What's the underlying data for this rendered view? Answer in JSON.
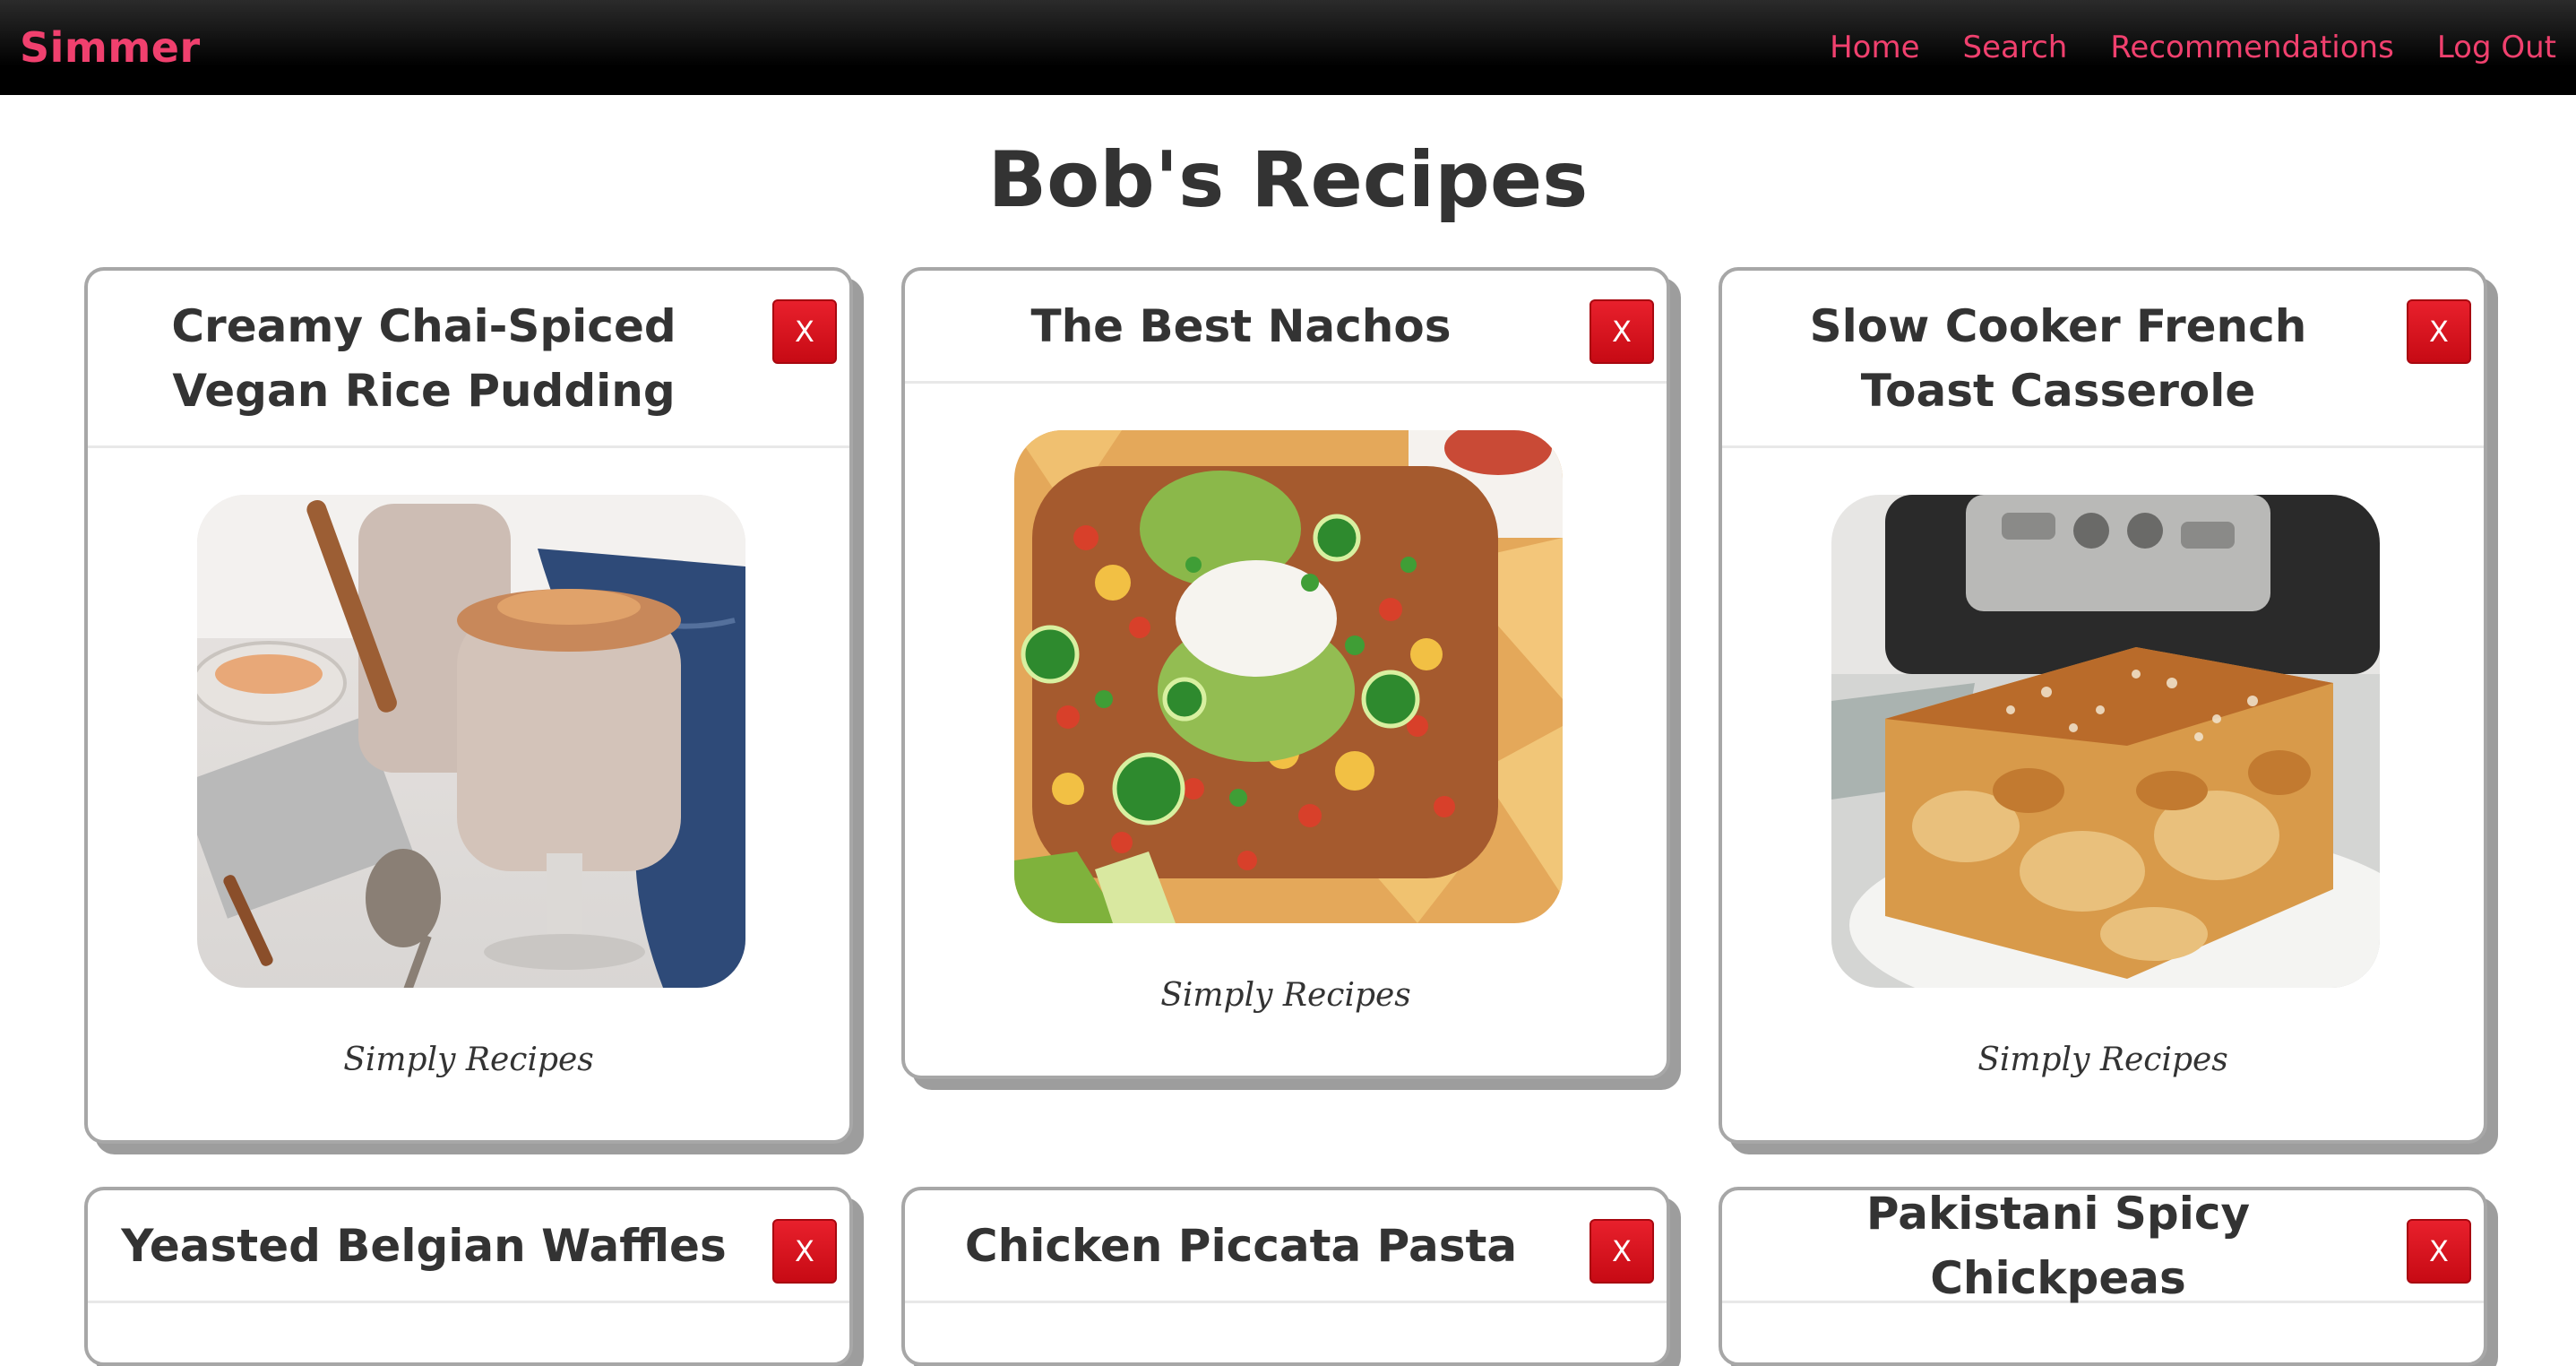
{
  "nav": {
    "brand": "Simmer",
    "links": [
      "Home",
      "Search",
      "Recommendations",
      "Log Out"
    ]
  },
  "page": {
    "title": "Bob's Recipes"
  },
  "recipes": [
    {
      "title": "Creamy Chai-Spiced Vegan Rice Pudding",
      "source": "Simply Recipes",
      "remove_label": "X",
      "image": "rice-pudding-photo"
    },
    {
      "title": "The Best Nachos",
      "source": "Simply Recipes",
      "remove_label": "X",
      "image": "nachos-photo"
    },
    {
      "title": "Slow Cooker French Toast Casserole",
      "source": "Simply Recipes",
      "remove_label": "X",
      "image": "french-toast-casserole-photo"
    },
    {
      "title": "Yeasted Belgian Waffles",
      "remove_label": "X"
    },
    {
      "title": "Chicken Piccata Pasta",
      "remove_label": "X"
    },
    {
      "title": "Pakistani Spicy Chickpeas",
      "remove_label": "X"
    }
  ],
  "colors": {
    "brand": "#f0406e",
    "nav_bg": "#000000",
    "remove_button": "#d9121c",
    "text": "#333333"
  }
}
